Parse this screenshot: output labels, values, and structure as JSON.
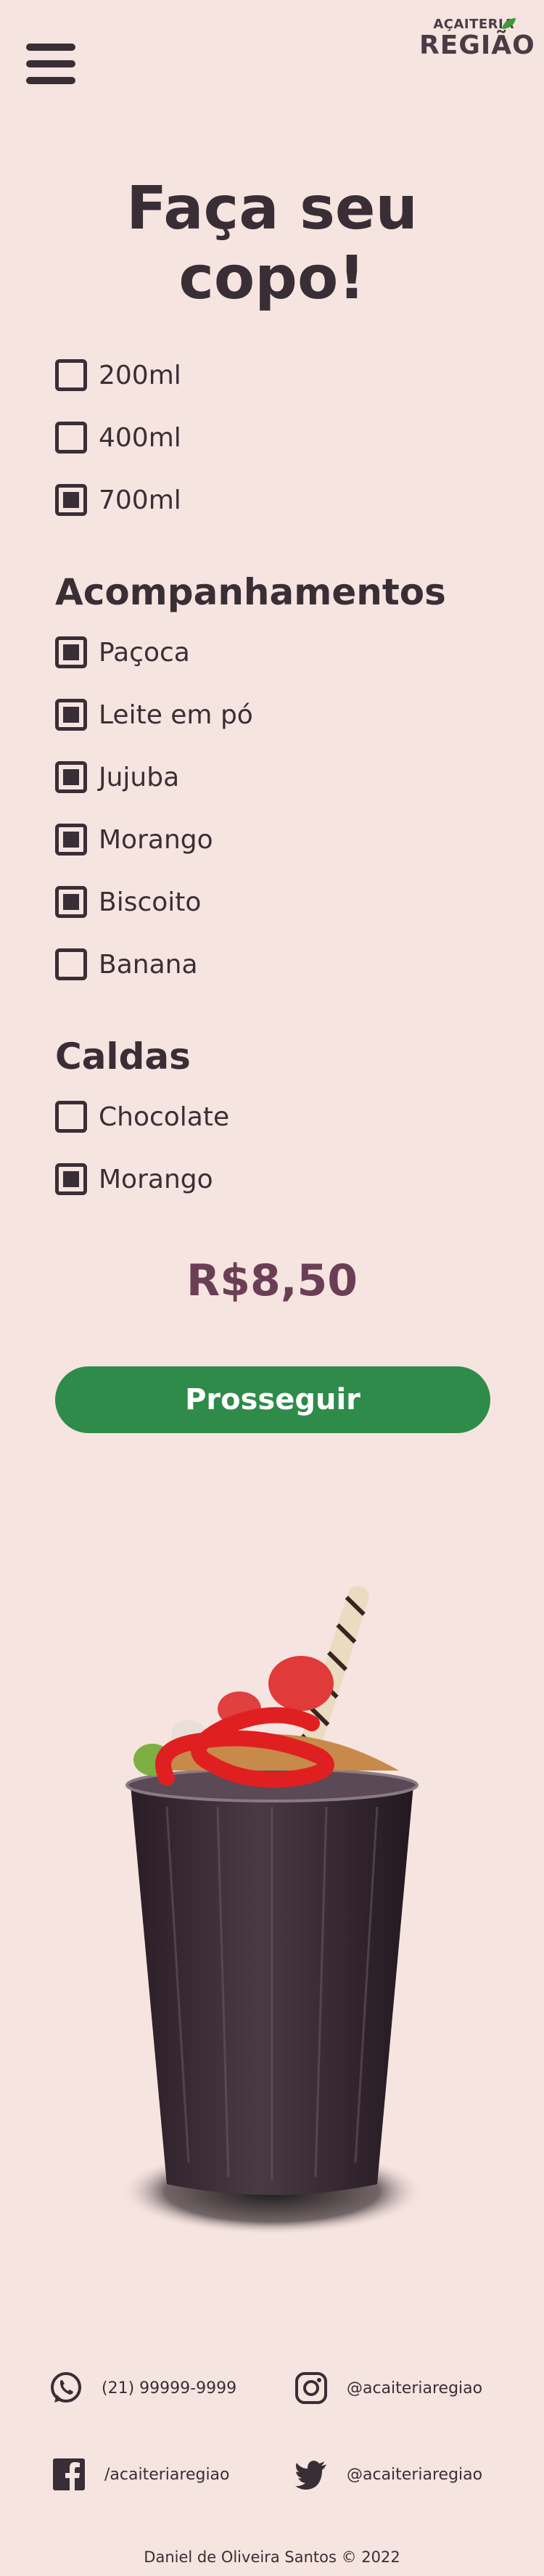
{
  "header": {
    "menu_icon": "hamburger-menu-icon",
    "logo_top": "AÇAITERIA",
    "logo_main": "REGIÃO"
  },
  "title": {
    "line1": "Faça seu",
    "line2": "copo!"
  },
  "sizes": [
    {
      "label": "200ml",
      "checked": false
    },
    {
      "label": "400ml",
      "checked": false
    },
    {
      "label": "700ml",
      "checked": true
    }
  ],
  "toppings": {
    "title": "Acompanhamentos",
    "items": [
      {
        "label": "Paçoca",
        "checked": true
      },
      {
        "label": "Leite em pó",
        "checked": true
      },
      {
        "label": "Jujuba",
        "checked": true
      },
      {
        "label": "Morango",
        "checked": true
      },
      {
        "label": "Biscoito",
        "checked": true
      },
      {
        "label": "Banana",
        "checked": false
      }
    ]
  },
  "syrups": {
    "title": "Caldas",
    "items": [
      {
        "label": "Chocolate",
        "checked": false
      },
      {
        "label": "Morango",
        "checked": true
      }
    ]
  },
  "price": "R$8,50",
  "cta_label": "Prosseguir",
  "footer": {
    "phone": "(21) 99999-9999",
    "instagram": "@acaiteriaregiao",
    "facebook": "/acaiteriaregiao",
    "twitter": "@acaiteriaregiao",
    "copyright": "Daniel de Oliveira Santos © 2022"
  },
  "colors": {
    "background": "#f6e4e0",
    "text": "#3a2e36",
    "price": "#6a3f55",
    "button": "#2e8b4a"
  }
}
